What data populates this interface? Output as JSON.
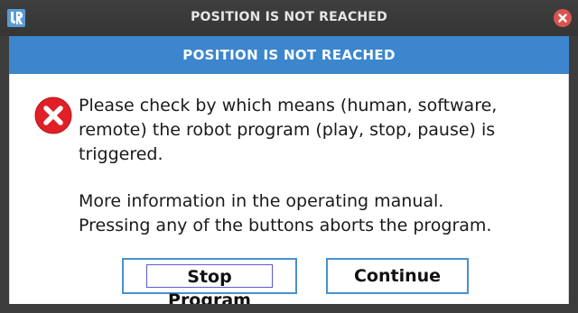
{
  "window": {
    "title": "POSITION IS NOT REACHED",
    "logo_icon": "universal-robots-logo",
    "close_icon": "close-icon",
    "close_color": "#d9534f"
  },
  "dialog": {
    "header": "POSITION IS NOT REACHED",
    "header_color": "#3c86cd",
    "icon": "error-icon",
    "message_primary": "Please check by which means (human, software,\nremote) the robot program (play, stop, pause) is\ntriggered.",
    "message_secondary": "More information in the operating manual.\nPressing any of the buttons aborts the program."
  },
  "buttons": {
    "stop_program": "Stop Program",
    "continue": "Continue"
  }
}
